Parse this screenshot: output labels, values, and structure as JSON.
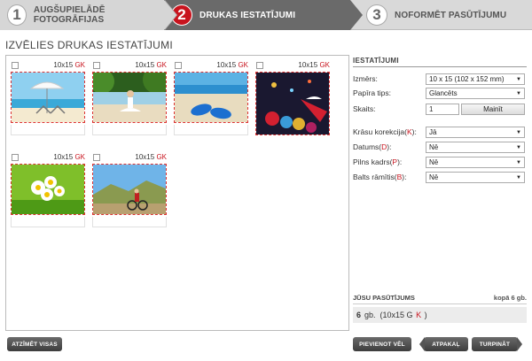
{
  "steps": [
    {
      "num": "1",
      "label": "AUGŠUPIELĀDĒ FOTOGRĀFIJAS"
    },
    {
      "num": "2",
      "label": "DRUKAS IESTATĪJUMI"
    },
    {
      "num": "3",
      "label": "NOFORMĒT PASŪTĪJUMU"
    }
  ],
  "page_title": "IZVĒLIES DRUKAS IESTATĪJUMI",
  "photos": [
    {
      "size": "10x15",
      "finish": "GK",
      "icon": "beach-umbrella-chairs-photo"
    },
    {
      "size": "10x15",
      "finish": "GK",
      "icon": "yoga-woman-photo"
    },
    {
      "size": "10x15",
      "finish": "GK",
      "icon": "flip-flops-sand-photo"
    },
    {
      "size": "10x15",
      "finish": "GK",
      "icon": "christmas-ornaments-photo"
    },
    {
      "size": "10x15",
      "finish": "GK",
      "icon": "daisies-photo"
    },
    {
      "size": "10x15",
      "finish": "GK",
      "icon": "cyclist-photo"
    }
  ],
  "settings": {
    "header": "IESTATĪJUMI",
    "size_label": "Izmērs:",
    "size_value": "10 x 15 (102 x 152 mm)",
    "paper_label": "Papīra tips:",
    "paper_value": "Glancēts",
    "count_label": "Skaits:",
    "count_value": "1",
    "change_button": "Mainīt",
    "color_label_pre": "Krāsu korekcija(",
    "color_key": "K",
    "color_label_post": "):",
    "color_value": "Jā",
    "date_label_pre": "Datums(",
    "date_key": "D",
    "date_label_post": "):",
    "date_value": "Nē",
    "full_label_pre": "Pilns kadrs(",
    "full_key": "P",
    "full_label_post": "):",
    "full_value": "Nē",
    "border_label_pre": "Balts rāmītis(",
    "border_key": "B",
    "border_label_post": "):",
    "border_value": "Nē"
  },
  "order": {
    "header": "JŪSU PASŪTĪJUMS",
    "total": "kopā 6 gb.",
    "qty": "6",
    "unit": "gb.",
    "detail_pre": "(10x15 G",
    "detail_key": "K",
    "detail_post": ")"
  },
  "buttons": {
    "mark_all": "ATZĪMĒT VISAS",
    "add_more": "PIEVIENOT VĒL",
    "back": "ATPAKAĻ",
    "continue": "TURPINĀT"
  },
  "colors": {
    "accent": "#c8141e",
    "active_step": "#6a6a6a"
  }
}
